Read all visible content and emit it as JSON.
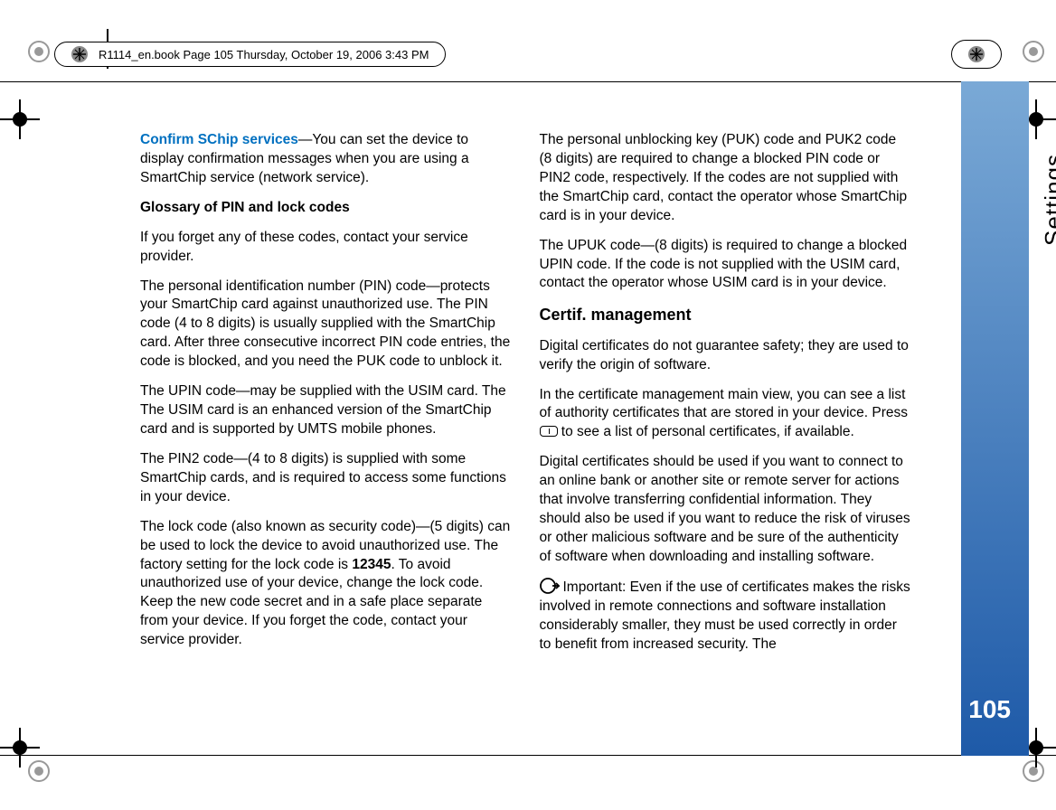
{
  "header": {
    "text": "R1114_en.book  Page 105  Thursday, October 19, 2006  3:43 PM"
  },
  "side": {
    "label": "Settings",
    "page_number": "105"
  },
  "left_col": {
    "p1_term": "Confirm SChip services",
    "p1_rest": "—You can set the device to display confirmation messages when you are using a SmartChip service (network service).",
    "glossary_head": "Glossary of PIN and lock codes",
    "p2": "If you forget any of these codes, contact your service provider.",
    "p3": "The personal identification number (PIN) code—protects your SmartChip card against unauthorized use. The PIN code (4 to 8 digits) is usually supplied with the SmartChip card. After three consecutive incorrect PIN code entries, the code is blocked, and you need the PUK code to unblock it.",
    "p4": "The UPIN code—may be supplied with the USIM card. The The USIM card is an enhanced version of the SmartChip card and is supported by UMTS mobile phones.",
    "p5": "The PIN2 code—(4 to 8 digits) is supplied with some SmartChip cards, and is required to access some functions in your device.",
    "p6a": "The lock code (also known as security code)—(5 digits) can be used to lock the device to avoid unauthorized use. The factory setting for the lock code is ",
    "p6_code": "12345",
    "p6b": ". To avoid unauthorized use of your device, change the lock code. Keep the new code secret and in a safe place separate from your device. If you forget the code, contact your service provider."
  },
  "right_col": {
    "p1": "The personal unblocking key (PUK) code and PUK2 code (8 digits) are required to change a blocked PIN code or PIN2 code, respectively. If the codes are not supplied with the SmartChip card, contact the operator whose SmartChip card is in your device.",
    "p2": "The UPUK code—(8 digits) is required to change a blocked UPIN code. If the code is not supplied with the USIM card, contact the operator whose USIM card is in your device.",
    "section_head": "Certif. management",
    "p3": "Digital certificates do not guarantee safety; they are used to verify the origin of software.",
    "p4a": "In the certificate management main view, you can see a list of authority certificates that are stored in your device. Press ",
    "p4b": " to see a list of personal certificates, if available.",
    "p5": "Digital certificates should be used if you want to connect to an online bank or another site or remote server for actions that involve transferring confidential information. They should also be used if you want to reduce the risk of viruses or other malicious software and be sure of the authenticity of software when downloading and installing software.",
    "p6": "Important: Even if the use of certificates makes the risks involved in remote connections and software installation considerably smaller, they must be used correctly in order to benefit from increased security. The"
  }
}
